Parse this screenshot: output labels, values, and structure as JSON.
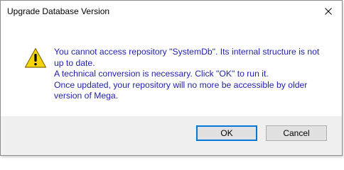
{
  "window": {
    "title": "Upgrade Database Version",
    "close_icon": "close-icon"
  },
  "message": {
    "icon": "warning-icon",
    "icon_color": "#f5d40a",
    "text_color": "#1f1fb0",
    "lines": [
      "You cannot access repository \"SystemDb\". Its internal structure is not",
      "up to date.",
      "A technical conversion is necessary. Click \"OK\" to run it.",
      "Once updated, your repository will no more be accessible by older",
      "version of Mega."
    ]
  },
  "buttons": {
    "ok_label": "OK",
    "cancel_label": "Cancel",
    "accent": "#0078d7"
  }
}
